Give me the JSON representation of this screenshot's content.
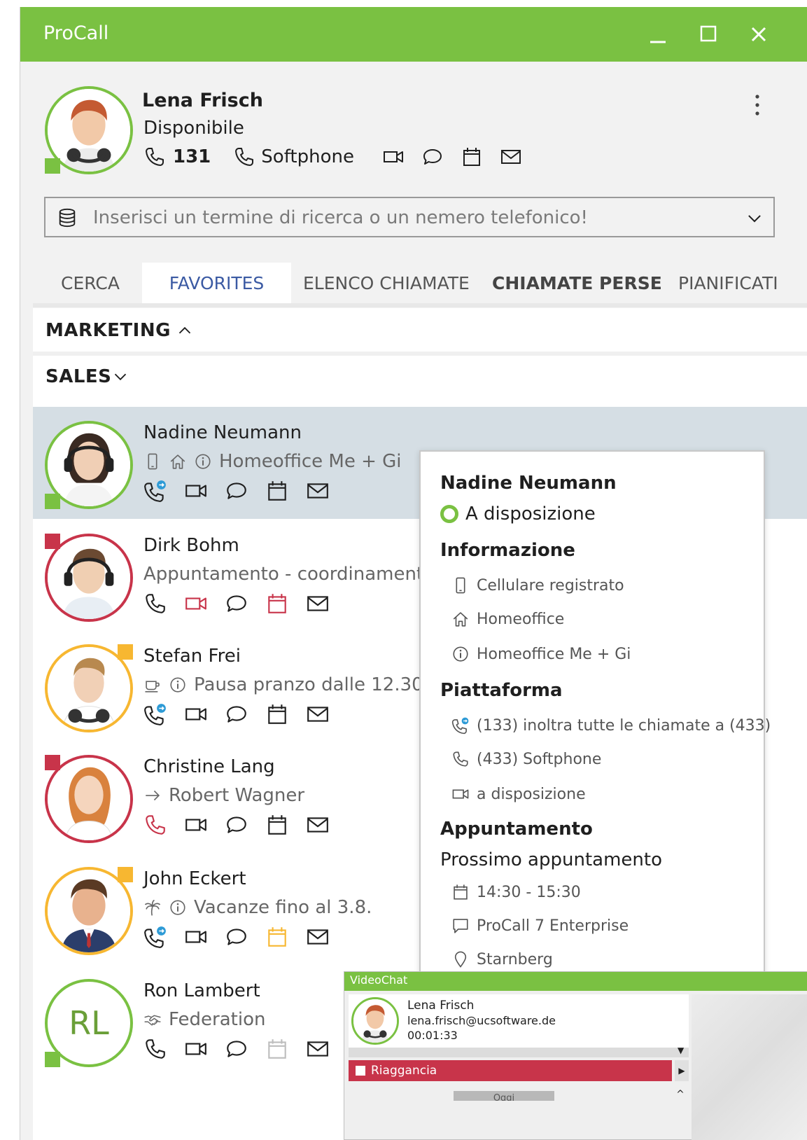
{
  "window": {
    "title": "ProCall",
    "accent_color": "#7ac142",
    "controls": [
      "minimize-icon",
      "maximize-icon",
      "close-icon"
    ]
  },
  "profile": {
    "name": "Lena Frisch",
    "status": "Disponibile",
    "extension": "131",
    "device": "Softphone",
    "actions": [
      "video-icon",
      "chat-icon",
      "calendar-icon",
      "mail-icon"
    ]
  },
  "search": {
    "placeholder": "Inserisci un termine di ricerca o un nemero telefonico!"
  },
  "tabs": [
    {
      "label": "CERCA",
      "active": false
    },
    {
      "label": "FAVORITES",
      "active": true
    },
    {
      "label": "ELENCO CHIAMATE",
      "active": false
    },
    {
      "label": "CHIAMATE PERSE",
      "active": false
    },
    {
      "label": "PIANIFICATI",
      "active": false
    }
  ],
  "groups": {
    "marketing": "MARKETING",
    "sales": "SALES"
  },
  "contacts": [
    {
      "name": "Nadine Neumann",
      "status": "Homeoffice Me + Gi",
      "presence_color": "#7ac142"
    },
    {
      "name": "Dirk Bohm",
      "status": "Appuntamento - coordinamento",
      "presence_color": "#c8344a"
    },
    {
      "name": "Stefan Frei",
      "status": "Pausa pranzo dalle 12.30",
      "presence_color": "#f7b731"
    },
    {
      "name": "Christine Lang",
      "status": "Robert Wagner",
      "presence_color": "#c8344a"
    },
    {
      "name": "John Eckert",
      "status": "Vacanze fino al 3.8.",
      "presence_color": "#f7b731"
    },
    {
      "name": "Ron Lambert",
      "status": "Federation",
      "initials": "RL",
      "presence_color": "#7ac142"
    }
  ],
  "popup": {
    "name": "Nadine Neumann",
    "presence": "A disposizione",
    "info_title": "Informazione",
    "info": [
      "Cellulare registrato",
      "Homeoffice",
      "Homeoffice Me + Gi"
    ],
    "platform_title": "Piattaforma",
    "platform": [
      "(133) inoltra tutte le chiamate a (433)",
      "(433) Softphone",
      "a disposizione"
    ],
    "appointment_title": "Appuntamento",
    "next_label": "Prossimo appuntamento",
    "appointment": [
      "14:30 - 15:30",
      "ProCall 7 Enterprise",
      "Starnberg"
    ]
  },
  "videochat": {
    "title": "VideoChat",
    "name": "Lena Frisch",
    "email": "lena.frisch@ucsoftware.de",
    "duration": "00:01:33",
    "hangup_label": "Riaggancia",
    "bottom_tab": "Oggi"
  }
}
